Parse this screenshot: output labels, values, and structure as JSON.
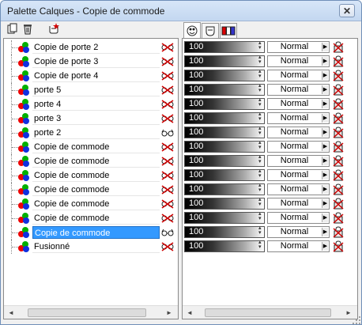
{
  "window": {
    "title": "Palette Calques - Copie de commode",
    "close_label": "✕"
  },
  "toolbar": {
    "icons": [
      "duplicate-icon",
      "trash-icon",
      "new-layer-icon"
    ]
  },
  "tabs": [
    {
      "icon": "layer-palette-icon",
      "active": true
    },
    {
      "icon": "mask-icon",
      "active": false
    },
    {
      "icon": "channels-icon",
      "active": false
    }
  ],
  "layers": [
    {
      "name": "Copie de porte 2",
      "visible": false,
      "selected": false
    },
    {
      "name": "Copie de porte 3",
      "visible": false,
      "selected": false
    },
    {
      "name": "Copie de porte 4",
      "visible": false,
      "selected": false
    },
    {
      "name": "porte 5",
      "visible": false,
      "selected": false
    },
    {
      "name": "porte 4",
      "visible": false,
      "selected": false
    },
    {
      "name": "porte 3",
      "visible": false,
      "selected": false
    },
    {
      "name": "porte 2",
      "visible": true,
      "selected": false
    },
    {
      "name": "Copie de commode",
      "visible": false,
      "selected": false
    },
    {
      "name": "Copie de commode",
      "visible": false,
      "selected": false
    },
    {
      "name": "Copie de commode",
      "visible": false,
      "selected": false
    },
    {
      "name": "Copie de commode",
      "visible": false,
      "selected": false
    },
    {
      "name": "Copie de commode",
      "visible": false,
      "selected": false
    },
    {
      "name": "Copie de commode",
      "visible": false,
      "selected": false
    },
    {
      "name": "Copie de commode",
      "visible": true,
      "selected": true
    },
    {
      "name": "Fusionné",
      "visible": false,
      "selected": false
    }
  ],
  "props": [
    {
      "opacity": "100",
      "blend": "Normal"
    },
    {
      "opacity": "100",
      "blend": "Normal"
    },
    {
      "opacity": "100",
      "blend": "Normal"
    },
    {
      "opacity": "100",
      "blend": "Normal"
    },
    {
      "opacity": "100",
      "blend": "Normal"
    },
    {
      "opacity": "100",
      "blend": "Normal"
    },
    {
      "opacity": "100",
      "blend": "Normal"
    },
    {
      "opacity": "100",
      "blend": "Normal"
    },
    {
      "opacity": "100",
      "blend": "Normal"
    },
    {
      "opacity": "100",
      "blend": "Normal"
    },
    {
      "opacity": "100",
      "blend": "Normal"
    },
    {
      "opacity": "100",
      "blend": "Normal"
    },
    {
      "opacity": "100",
      "blend": "Normal"
    },
    {
      "opacity": "100",
      "blend": "Normal"
    },
    {
      "opacity": "100",
      "blend": "Normal"
    }
  ],
  "colors": {
    "selection": "#3399ff",
    "hidden_eye": "#cc0000"
  }
}
